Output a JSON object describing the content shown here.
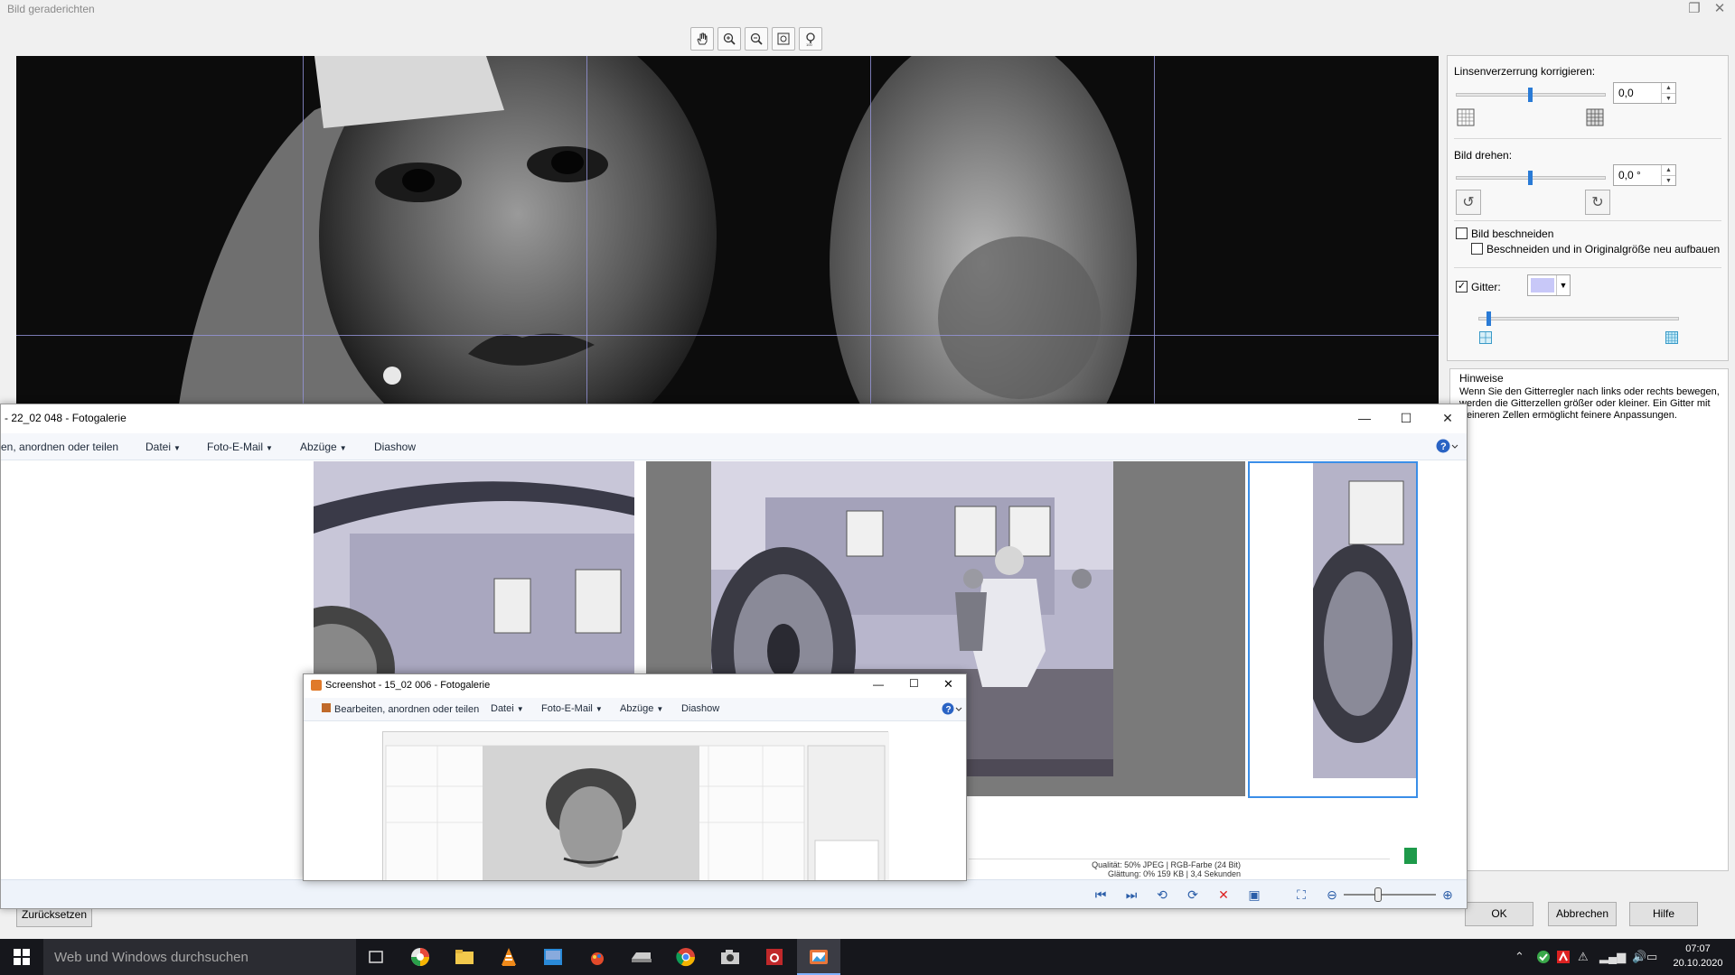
{
  "dialog": {
    "title": "Bild geraderichten",
    "toolbar": {
      "hand_icon": "hand-tool-icon",
      "zoom_in_icon": "zoom-in-icon",
      "zoom_out_icon": "zoom-out-icon",
      "fit_icon": "fit-to-window-icon",
      "actual_size_icon": "actual-size-icon"
    },
    "panel": {
      "lens_label": "Linsenverzerrung korrigieren:",
      "lens_value": "0,0",
      "rotate_label": "Bild drehen:",
      "rotate_value": "0,0 °",
      "crop_label": "Bild beschneiden",
      "crop_checked": false,
      "crop_rebuild_label": "Beschneiden und in Originalgröße neu aufbauen",
      "crop_rebuild_checked": false,
      "grid_label": "Gitter:",
      "grid_checked": true,
      "grid_color": "#c8c8f8"
    },
    "hints": {
      "title": "Hinweise",
      "text": "Wenn Sie den Gitterregler nach links oder rechts bewegen, werden die Gitterzellen größer oder kleiner. Ein Gitter mit kleineren Zellen ermöglicht feinere Anpassungen."
    },
    "buttons": {
      "reset": "Zurücksetzen",
      "ok": "OK",
      "cancel": "Abbrechen",
      "help": "Hilfe"
    }
  },
  "gallery": {
    "title": "- 22_02 048 - Fotogalerie",
    "menu": {
      "edit": "en, anordnen oder teilen",
      "file": "Datei",
      "email": "Foto-E-Mail",
      "prints": "Abzüge",
      "slideshow": "Diashow"
    },
    "info_line1": "Qualität: 50%   JPEG  |  RGB-Farbe (24 Bit)",
    "info_line2": "Glättung: 0%   159 KB  |  3,4 Sekunden"
  },
  "gallery2": {
    "title": "Screenshot - 15_02 006 - Fotogalerie",
    "menu": {
      "edit": "Bearbeiten, anordnen oder teilen",
      "file": "Datei",
      "email": "Foto-E-Mail",
      "prints": "Abzüge",
      "slideshow": "Diashow"
    }
  },
  "taskbar": {
    "search_placeholder": "Web und Windows durchsuchen",
    "time": "07:07",
    "date": "20.10.2020"
  }
}
